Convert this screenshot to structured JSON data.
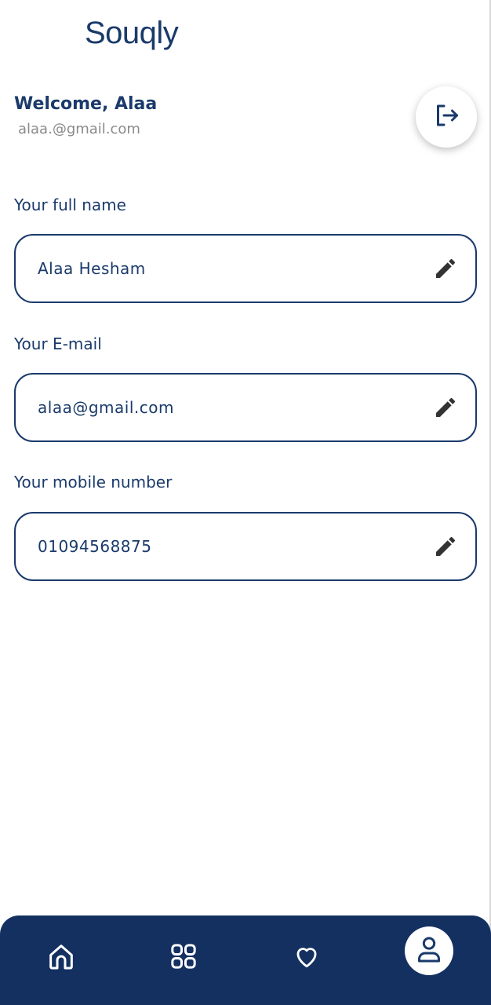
{
  "app": {
    "brand": "Souqly"
  },
  "header": {
    "welcome": "Welcome, Alaa",
    "email": "alaa.@gmail.com",
    "logout_icon": "logout-icon"
  },
  "form": {
    "fields": [
      {
        "label": "Your full name",
        "value": "Alaa Hesham",
        "icon": "pencil-icon"
      },
      {
        "label": "Your E-mail",
        "value": "alaa@gmail.com",
        "icon": "pencil-icon"
      },
      {
        "label": "Your mobile number",
        "value": "01094568875",
        "icon": "pencil-icon"
      }
    ]
  },
  "nav": {
    "items": [
      {
        "icon": "home-icon",
        "active": false
      },
      {
        "icon": "grid-icon",
        "active": false
      },
      {
        "icon": "heart-icon",
        "active": false
      },
      {
        "icon": "profile-icon",
        "active": true
      }
    ]
  },
  "colors": {
    "primary": "#1a3a6b",
    "nav_background": "#133061",
    "secondary_text": "#8a8a8a",
    "background": "#ffffff"
  }
}
